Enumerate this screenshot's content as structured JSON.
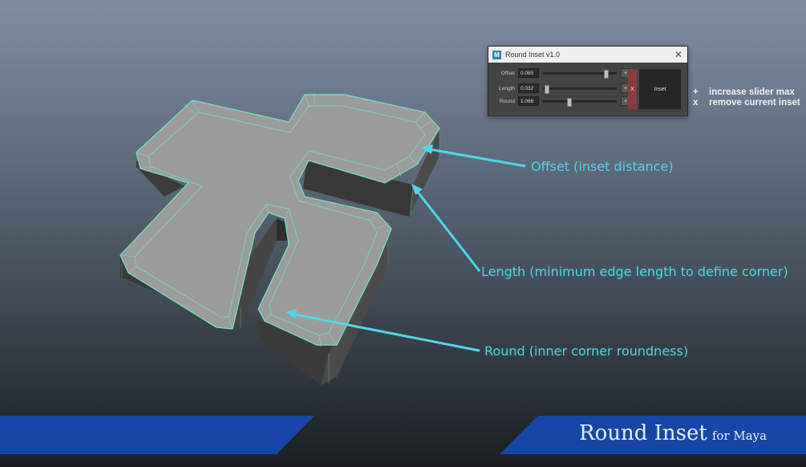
{
  "dialog": {
    "title": "Round Inset v1.0",
    "app_icon": "M",
    "close_glyph": "✕",
    "rows": [
      {
        "label": "Offset",
        "value": "0.080",
        "slider_fraction": 0.88,
        "plus": "+"
      },
      {
        "label": "Length",
        "value": "0.032",
        "slider_fraction": 0.02,
        "plus": "+"
      },
      {
        "label": "Round",
        "value": "1.066",
        "slider_fraction": 0.35,
        "plus": "+"
      }
    ],
    "remove_label": "X",
    "inset_label": "Inset"
  },
  "help": [
    {
      "key": "+",
      "text": "increase slider max"
    },
    {
      "key": "x",
      "text": "remove current inset"
    }
  ],
  "annotations": {
    "offset": "Offset (inset distance)",
    "length": "Length (minimum edge length to define corner)",
    "round": "Round (inner corner roundness)"
  },
  "branding": {
    "title": "Round Inset",
    "subtitle": "for Maya"
  },
  "colors": {
    "accent": "#4fd7e6",
    "banner": "#1747a6",
    "wire": "#6fe8c2"
  }
}
